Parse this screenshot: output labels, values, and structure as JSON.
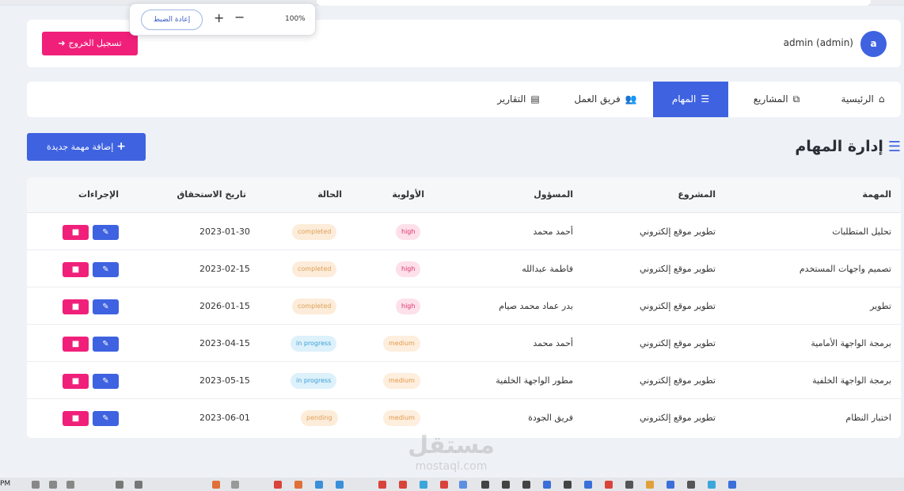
{
  "zoom": {
    "reset_label": "إعادة الضبط",
    "plus": "+",
    "minus": "−",
    "level": "100%"
  },
  "header": {
    "logout_label": "تسجيل الخروج",
    "user_name": "admin (admin)",
    "avatar_letter": "a"
  },
  "nav": {
    "items": [
      {
        "label": "الرئيسية",
        "icon": "home-icon"
      },
      {
        "label": "المشاريع",
        "icon": "project-diagram-icon"
      },
      {
        "label": "المهام",
        "icon": "tasks-icon",
        "active": true
      },
      {
        "label": "فريق العمل",
        "icon": "users-icon"
      },
      {
        "label": "التقارير",
        "icon": "chart-icon"
      }
    ]
  },
  "page": {
    "title": "إدارة المهام",
    "add_button": "إضافة مهمة جديدة"
  },
  "table": {
    "headers": {
      "task": "المهمة",
      "project": "المشروع",
      "owner": "المسؤول",
      "priority": "الأولوية",
      "status": "الحالة",
      "due": "تاريخ الاستحقاق",
      "actions": "الإجراءات"
    },
    "rows": [
      {
        "task": "تحليل المتطلبات",
        "project": "تطوير موقع إلكتروني",
        "owner": "أحمد محمد",
        "priority": "high",
        "status": "completed",
        "due": "2023-01-30"
      },
      {
        "task": "تصميم واجهات المستخدم",
        "project": "تطوير موقع إلكتروني",
        "owner": "فاطمة عبدالله",
        "priority": "high",
        "status": "completed",
        "due": "2023-02-15"
      },
      {
        "task": "تطوير",
        "project": "تطوير موقع إلكتروني",
        "owner": "بدر عماد محمد صيام",
        "priority": "high",
        "status": "completed",
        "due": "2026-01-15"
      },
      {
        "task": "برمجة الواجهة الأمامية",
        "project": "تطوير موقع إلكتروني",
        "owner": "أحمد محمد",
        "priority": "medium",
        "status": "in progress",
        "due": "2023-04-15"
      },
      {
        "task": "برمجة الواجهة الخلفية",
        "project": "تطوير موقع إلكتروني",
        "owner": "مطور الواجهة الخلفية",
        "priority": "medium",
        "status": "in progress",
        "due": "2023-05-15"
      },
      {
        "task": "اختبار النظام",
        "project": "تطوير موقع إلكتروني",
        "owner": "فريق الجودة",
        "priority": "medium",
        "status": "pending",
        "due": "2023-06-01"
      }
    ]
  },
  "watermark": {
    "brand": "مستقل",
    "site": "mostaql.com"
  },
  "taskbar": {
    "time": "PM"
  },
  "colors": {
    "primary": "#3e62e0",
    "danger": "#f0207a",
    "background": "#eef1f6"
  }
}
